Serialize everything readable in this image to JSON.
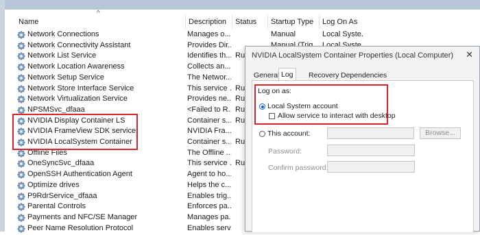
{
  "columns": [
    "Name",
    "Description",
    "Status",
    "Startup Type",
    "Log On As"
  ],
  "services": [
    {
      "name": "Network Connections",
      "description": "Manages o...",
      "status": "",
      "startup": "Manual",
      "logon": "Local Syste..."
    },
    {
      "name": "Network Connectivity Assistant",
      "description": "Provides Dir...",
      "status": "",
      "startup": "Manual (Trig...",
      "logon": "Local Syste..."
    },
    {
      "name": "Network List Service",
      "description": "Identifies th...",
      "status": "Run",
      "startup": "",
      "logon": ""
    },
    {
      "name": "Network Location Awareness",
      "description": "Collects an...",
      "status": "",
      "startup": "",
      "logon": ""
    },
    {
      "name": "Network Setup Service",
      "description": "The Networ...",
      "status": "",
      "startup": "",
      "logon": ""
    },
    {
      "name": "Network Store Interface Service",
      "description": "This service ...",
      "status": "Run",
      "startup": "",
      "logon": ""
    },
    {
      "name": "Network Virtualization Service",
      "description": "Provides ne...",
      "status": "Run",
      "startup": "",
      "logon": ""
    },
    {
      "name": "NPSMSvc_dfaaa",
      "description": "<Failed to R...",
      "status": "Run",
      "startup": "",
      "logon": ""
    },
    {
      "name": "NVIDIA Display Container LS",
      "description": "Container s...",
      "status": "Run",
      "startup": "",
      "logon": ""
    },
    {
      "name": "NVIDIA FrameView SDK service",
      "description": "NVIDIA Fra...",
      "status": "",
      "startup": "",
      "logon": ""
    },
    {
      "name": "NVIDIA LocalSystem Container",
      "description": "Container s...",
      "status": "Run",
      "startup": "",
      "logon": ""
    },
    {
      "name": "Offline Files",
      "description": "The Offline ...",
      "status": "",
      "startup": "",
      "logon": ""
    },
    {
      "name": "OneSyncSvc_dfaaa",
      "description": "This service ...",
      "status": "Run",
      "startup": "",
      "logon": ""
    },
    {
      "name": "OpenSSH Authentication Agent",
      "description": "Agent to ho...",
      "status": "",
      "startup": "",
      "logon": ""
    },
    {
      "name": "Optimize drives",
      "description": "Helps the c...",
      "status": "",
      "startup": "",
      "logon": ""
    },
    {
      "name": "P9RdrService_dfaaa",
      "description": "Enables trig...",
      "status": "",
      "startup": "",
      "logon": ""
    },
    {
      "name": "Parental Controls",
      "description": "Enforces pa...",
      "status": "",
      "startup": "",
      "logon": ""
    },
    {
      "name": "Payments and NFC/SE Manager",
      "description": "Manages pa...",
      "status": "",
      "startup": "",
      "logon": ""
    },
    {
      "name": "Peer Name Resolution Protocol",
      "description": "Enables serv...",
      "status": "",
      "startup": "",
      "logon": ""
    }
  ],
  "dialog": {
    "title": "NVIDIA LocalSystem Container Properties (Local Computer)",
    "close_glyph": "✕",
    "tabs": [
      "General",
      "Log On",
      "Recovery",
      "Dependencies"
    ],
    "logon_label": "Log on as:",
    "local_system": "Local System account",
    "allow_interact": "Allow service to interact with desktop",
    "this_account": "This account:",
    "browse": "Browse...",
    "password": "Password:",
    "confirm_password": "Confirm password:"
  },
  "colors": {
    "highlight": "#d9242a",
    "radio_selected": "#1560d4"
  },
  "icons": {
    "service": "gear-icon",
    "sort": "sort-up-icon"
  }
}
